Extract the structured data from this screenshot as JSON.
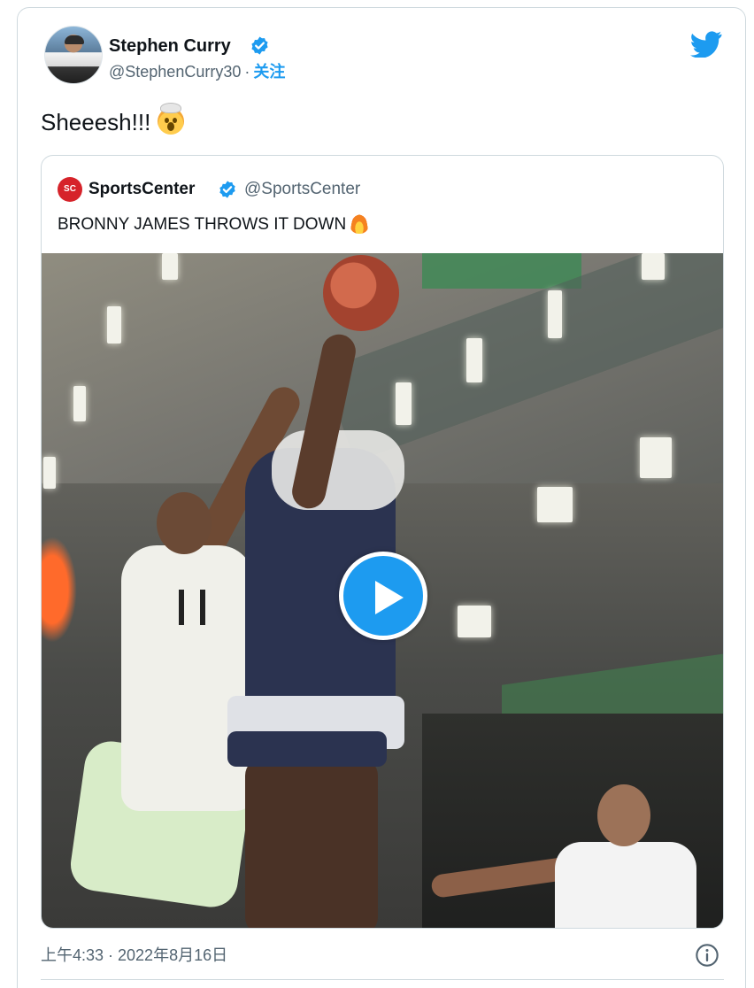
{
  "tweet": {
    "author": {
      "name": "Stephen Curry",
      "handle": "@StephenCurry30",
      "separator": "·",
      "follow_label": "关注",
      "verified": true
    },
    "text": "Sheeesh!!!",
    "emoji": "exploding-head",
    "quoted": {
      "name": "SportsCenter",
      "handle": "@SportsCenter",
      "logo_text": "SC",
      "verified": true,
      "text": "BRONNY JAMES THROWS IT DOWN",
      "emoji": "fire",
      "media": {
        "type": "video",
        "play_icon": "play-icon"
      }
    },
    "timestamp": "上午4:33 · 2022年8月16日"
  },
  "colors": {
    "accent": "#1d9bf0",
    "text": "#0f1419",
    "secondary_text": "#536471",
    "border": "#cfd9de"
  },
  "icons": [
    "verified-icon",
    "twitter-bird-icon",
    "play-icon",
    "info-icon"
  ]
}
